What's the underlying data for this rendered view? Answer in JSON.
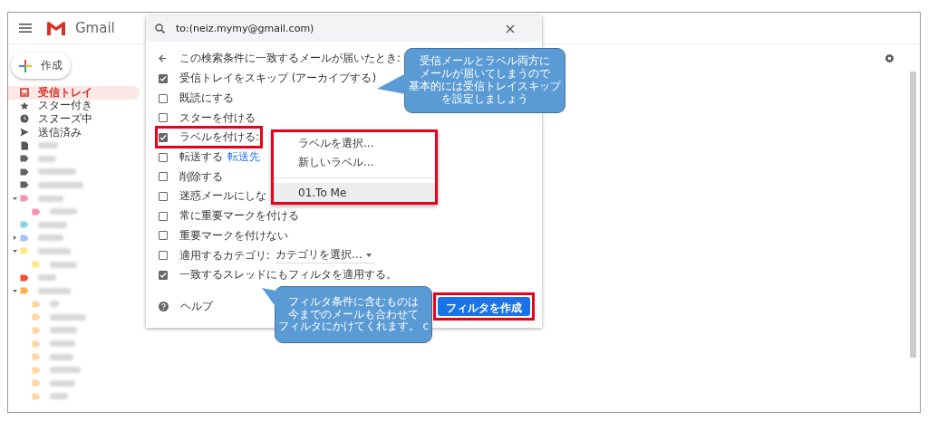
{
  "header": {
    "app_name": "Gmail"
  },
  "compose": {
    "label": "作成"
  },
  "sidebar": {
    "items": [
      {
        "kind": "inbox",
        "label": "受信トレイ",
        "selected": true
      },
      {
        "kind": "starred",
        "label": "スター付き",
        "selected": false
      },
      {
        "kind": "snoozed",
        "label": "スヌーズ中",
        "selected": false
      },
      {
        "kind": "sent",
        "label": "送信済み",
        "selected": false
      },
      {
        "kind": "drafts",
        "selected": false
      }
    ],
    "labels": [
      {
        "kind": "label",
        "color": "#5f6368"
      },
      {
        "kind": "label",
        "color": "#5f6368"
      },
      {
        "kind": "label",
        "color": "#5f6368"
      },
      {
        "kind": "folder",
        "color": "#f691b2",
        "expanded": true,
        "children": [
          {
            "kind": "label",
            "color": "#f691b2"
          }
        ]
      },
      {
        "kind": "label",
        "color": "#89d3e6"
      },
      {
        "kind": "folder",
        "color": "#a4c2f4",
        "expanded": false
      },
      {
        "kind": "folder",
        "color": "#fbe983",
        "expanded": true,
        "children": [
          {
            "kind": "label",
            "color": "#fbe983"
          }
        ]
      },
      {
        "kind": "label",
        "color": "#fb4c2f"
      },
      {
        "kind": "folder",
        "color": "#ffad47",
        "expanded": true,
        "children": [
          {
            "kind": "label",
            "color": "#ffd6a2"
          },
          {
            "kind": "label",
            "color": "#ffd6a2"
          },
          {
            "kind": "label",
            "color": "#ffd6a2"
          },
          {
            "kind": "label",
            "color": "#ffd6a2"
          },
          {
            "kind": "label",
            "color": "#ffd6a2"
          },
          {
            "kind": "label",
            "color": "#ffd6a2"
          },
          {
            "kind": "label",
            "color": "#ffd6a2"
          },
          {
            "kind": "label",
            "color": "#ffd6a2"
          }
        ]
      }
    ]
  },
  "search": {
    "value": "to:(neiz.mymy@gmail.com)"
  },
  "filter": {
    "heading": "この検索条件に一致するメールが届いたとき:",
    "options": [
      {
        "kind": "plain",
        "label": "受信トレイをスキップ (アーカイブする)",
        "checked": true
      },
      {
        "kind": "plain",
        "label": "既読にする",
        "checked": false
      },
      {
        "kind": "plain",
        "label": "スターを付ける",
        "checked": false
      },
      {
        "kind": "plain",
        "label": "ラベルを付ける:",
        "checked": true,
        "highlighted": true
      },
      {
        "kind": "link",
        "label": "転送する",
        "link": "転送先",
        "checked": false
      },
      {
        "kind": "plain",
        "label": "削除する",
        "checked": false
      },
      {
        "kind": "plain",
        "label": "迷惑メールにしな",
        "checked": false
      },
      {
        "kind": "plain",
        "label": "常に重要マークを付ける",
        "checked": false
      },
      {
        "kind": "plain",
        "label": "重要マークを付けない",
        "checked": false
      },
      {
        "kind": "category",
        "label": "適用するカテゴリ:",
        "dropdown": "カテゴリを選択...",
        "checked": false
      },
      {
        "kind": "plain",
        "label": "一致するスレッドにもフィルタを適用する。",
        "checked": true
      }
    ],
    "help": "ヘルプ",
    "create_button": "フィルタを作成"
  },
  "label_menu": {
    "items": [
      {
        "kind": "action",
        "label": "ラベルを選択...",
        "selected": false
      },
      {
        "kind": "action",
        "label": "新しいラベル...",
        "selected": false
      },
      {
        "kind": "label",
        "label": "01.To Me",
        "selected": true
      }
    ]
  },
  "callouts": [
    {
      "lines": [
        "受信メールとラベル両方に",
        "メールが届いてしまうので",
        "基本的には受信トレイスキップ",
        "を設定しましょう"
      ]
    },
    {
      "lines": [
        "フィルタ条件に含むものは",
        "今までのメールも合わせて",
        "フィルタにかけてくれます。 c"
      ]
    }
  ]
}
